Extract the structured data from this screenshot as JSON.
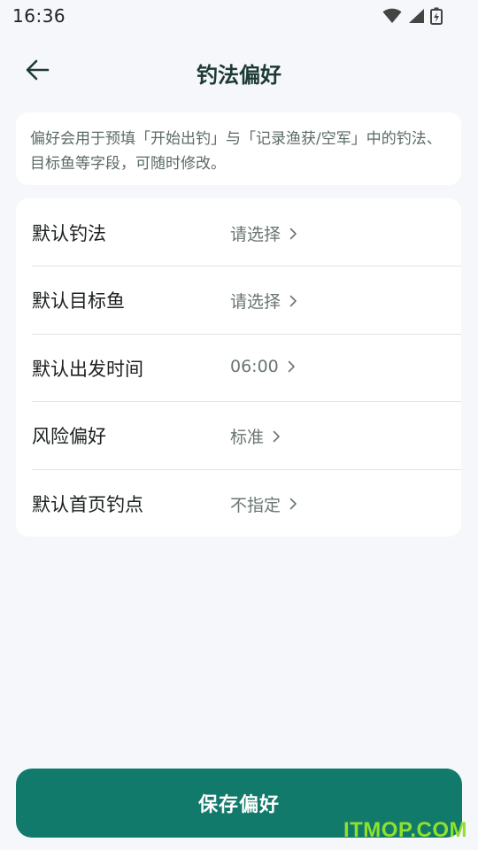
{
  "status_bar": {
    "time": "16:36",
    "icons": [
      "wifi-icon",
      "signal-icon",
      "battery-charging-icon"
    ]
  },
  "header": {
    "back_icon": "arrow-left-icon",
    "title": "钓法偏好"
  },
  "info": {
    "text": "偏好会用于预填「开始出钓」与「记录渔获/空军」中的钓法、目标鱼等字段，可随时修改。"
  },
  "settings": {
    "rows": [
      {
        "label": "默认钓法",
        "value": "请选择"
      },
      {
        "label": "默认目标鱼",
        "value": "请选择"
      },
      {
        "label": "默认出发时间",
        "value": "06:00"
      },
      {
        "label": "风险偏好",
        "value": "标准"
      },
      {
        "label": "默认首页钓点",
        "value": "不指定"
      }
    ]
  },
  "footer": {
    "save_label": "保存偏好"
  },
  "watermark": "ITMOP.COM",
  "colors": {
    "accent": "#117a6b",
    "title": "#1d3b35",
    "background": "#f6f7fb",
    "watermark": "#8fe02e"
  }
}
